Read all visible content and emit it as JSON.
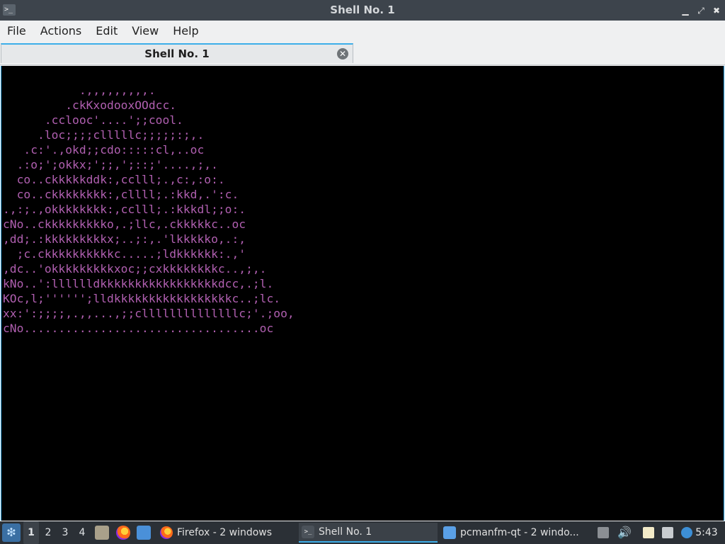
{
  "window": {
    "title": "Shell No. 1",
    "icon": "terminal-icon",
    "controls": [
      "minimize-icon",
      "maximize-icon",
      "close-icon"
    ]
  },
  "menu": {
    "items": [
      "File",
      "Actions",
      "Edit",
      "View",
      "Help"
    ]
  },
  "tabs": [
    {
      "label": "Shell No. 1",
      "close_icon": "tab-close-icon"
    }
  ],
  "terminal": {
    "text_color": "#b05fb0",
    "lines": [
      "           .,,,,,,,,,.",
      "         .ckKxodooxOOdcc.",
      "      .cclooc'....';;cool.",
      "     .loc;;;;clllllc;;;;;:;,.",
      "   .c:'.,okd;;cdo:::::cl,..oc",
      "  .:o;';okkx;';;,';::;'....,;,.",
      "  co..ckkkkkddk:,cclll;.,c:,:o:.",
      "  co..ckkkkkkkk:,cllll;.:kkd,.':c.",
      ".,:;.,okkkkkkkk:,cclll;.:kkkdl;;o:.",
      "cNo..ckkkkkkkkko,.;llc,.ckkkkkc..oc",
      ",dd;.:kkkkkkkkkx;..;:,.'lkkkkko,.:,",
      "  ;c.ckkkkkkkkkkc.....;ldkkkkkk:.,'",
      ",dc..'okkkkkkkkkxoc;;cxkkkkkkkkc..,;,.",
      "kNo..':lllllldkkkkkkkkkkkkkkkkkdcc,.;l.",
      "KOc,l;'''''';lldkkkkkkkkkkkkkkkkkc..;lc.",
      "xx:':;;;;,.,,...,;;cllllllllllllllc;'.;oo,",
      "cNo..................................oc"
    ]
  },
  "taskbar": {
    "start_icon": "start-menu-icon",
    "desktops": [
      "1",
      "2",
      "3",
      "4"
    ],
    "active_desktop": "1",
    "quicklaunch": [
      "show-desktop-icon",
      "firefox-icon",
      "file-manager-icon"
    ],
    "tasks": [
      {
        "label": "Firefox - 2 windows",
        "icon": "firefox-icon",
        "active": false
      },
      {
        "label": "Shell No. 1",
        "icon": "terminal-icon",
        "active": true
      },
      {
        "label": "pcmanfm-qt - 2 windo...",
        "icon": "folder-icon",
        "active": false
      }
    ],
    "tray": [
      "eject-icon",
      "volume-icon",
      "clipboard-icon",
      "network-icon",
      "notification-icon"
    ],
    "clock": "5:43"
  },
  "colors": {
    "accent": "#3daee9",
    "titlebar": "#3d444c",
    "taskbar": "#2b3036",
    "terminal_bg": "#000000"
  }
}
